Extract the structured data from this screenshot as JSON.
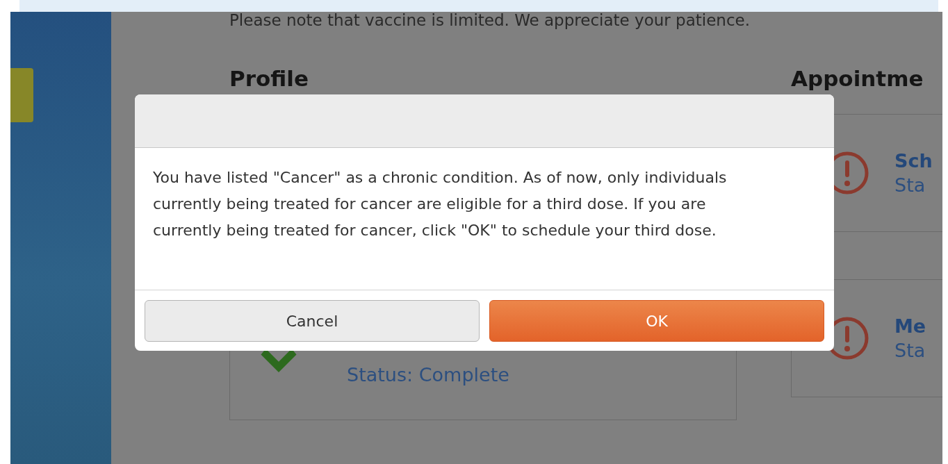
{
  "page": {
    "notice": "Please note that vaccine is limited. We appreciate your patience.",
    "profile": {
      "heading": "Profile",
      "cards": [
        {
          "kind": "complete",
          "status": "Status: Complete"
        }
      ]
    },
    "appointments": {
      "heading": "Appointme",
      "cards": [
        {
          "kind": "alert",
          "title": "Sch",
          "status": "Sta"
        },
        {
          "kind": "alert",
          "title": "Me",
          "status": "Sta"
        }
      ]
    }
  },
  "dialog": {
    "message": "You have listed \"Cancer\" as a chronic condition. As of now, only individuals currently being treated for cancer are eligible for a third dose. If you are currently being treated for cancer, click \"OK\" to schedule your third dose.",
    "buttons": [
      {
        "kind": "secondary",
        "label": "Cancel"
      },
      {
        "kind": "primary",
        "label": "OK"
      }
    ]
  }
}
